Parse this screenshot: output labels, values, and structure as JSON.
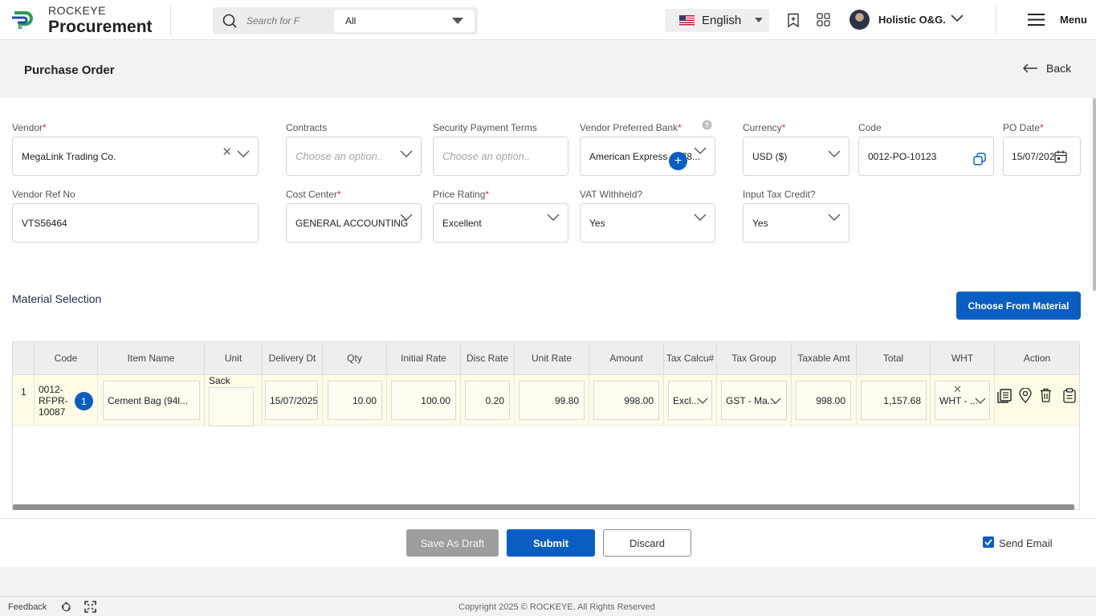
{
  "brand": {
    "top": "ROCKEYE",
    "bottom": "Procurement",
    "colors": {
      "accent": "#0a5ec2",
      "required": "#d9302c",
      "row_highlight": "#fffbe6"
    }
  },
  "header": {
    "search_placeholder": "Search for F",
    "search_scope": "All",
    "language": "English",
    "user_name": "Holistic O&G.",
    "menu_label": "Menu",
    "icons": [
      "search-icon",
      "bookmark-icon",
      "apps-grid-icon",
      "chevron-down-icon",
      "hamburger-icon"
    ]
  },
  "page": {
    "title": "Purchase Order",
    "back_label": "Back"
  },
  "form": {
    "vendor": {
      "label": "Vendor",
      "value": "MegaLink Trading Co."
    },
    "contracts": {
      "label": "Contracts",
      "placeholder": "Choose an option.."
    },
    "security_payment_terms": {
      "label": "Security Payment Terms",
      "placeholder": "Choose an option.."
    },
    "vendor_preferred_bank": {
      "label": "Vendor Preferred Bank",
      "value": "American Express - 778..."
    },
    "currency": {
      "label": "Currency",
      "value": "USD ($)"
    },
    "code": {
      "label": "Code",
      "value": "0012-PO-10123"
    },
    "po_date": {
      "label": "PO Date",
      "value": "15/07/2025"
    },
    "vendor_ref_no": {
      "label": "Vendor Ref No",
      "value": "VTS56464"
    },
    "cost_center": {
      "label": "Cost Center",
      "value": "GENERAL ACCOUNTING"
    },
    "price_rating": {
      "label": "Price Rating",
      "value": "Excellent"
    },
    "vat_withheld": {
      "label": "VAT Withheld?",
      "value": "Yes"
    },
    "input_tax_credit": {
      "label": "Input Tax Credit?",
      "value": "Yes"
    }
  },
  "materials": {
    "title": "Material Selection",
    "choose_button": "Choose From Material",
    "columns": [
      "Code",
      "Item Name",
      "Unit",
      "Delivery Dt",
      "Qty",
      "Initial Rate",
      "Disc Rate",
      "Unit Rate",
      "Amount",
      "Tax Calcu#",
      "Tax Group",
      "Taxable Amt",
      "Total",
      "WHT",
      "Action"
    ],
    "rows": [
      {
        "index": "1",
        "code": "0012-RFPR-10087",
        "code_line1": "0012-",
        "code_line2": "RFPR-",
        "code_line3": "10087",
        "badge": "1",
        "item_name": "Cement Bag (94l...",
        "unit": "Sack",
        "delivery_dt": "15/07/2025",
        "qty": "10.00",
        "initial_rate": "100.00",
        "disc_rate": "0.20",
        "unit_rate": "99.80",
        "amount": "998.00",
        "tax_calc": "Excl...",
        "tax_group": "GST - Ma...",
        "taxable_amt": "998.00",
        "total": "1,157.68",
        "wht": "WHT - ...",
        "action_icons": [
          "details-icon",
          "location-pin-icon",
          "trash-icon",
          "clipboard-icon"
        ]
      }
    ]
  },
  "footer": {
    "save_draft": "Save As Draft",
    "submit": "Submit",
    "discard": "Discard",
    "send_email": "Send Email",
    "send_email_checked": true,
    "feedback": "Feedback",
    "copyright": "Copyright 2025 © ROCKEYE. All Rights Reserved"
  }
}
